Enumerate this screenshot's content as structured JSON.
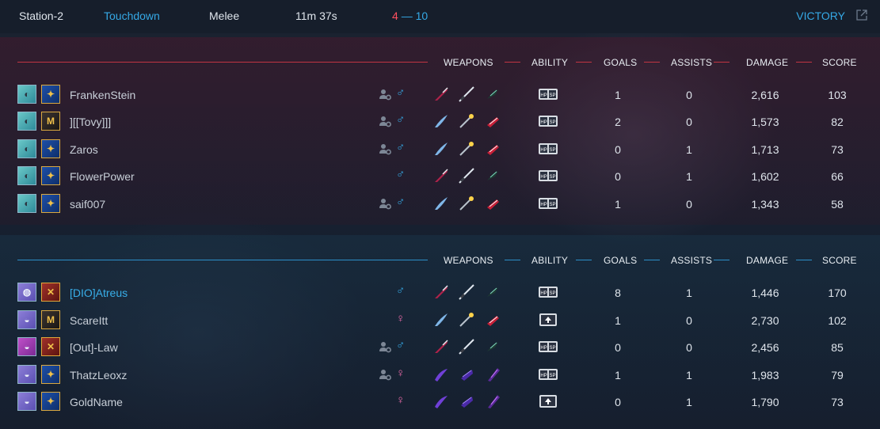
{
  "match": {
    "map": "Station-2",
    "mode": "Touchdown",
    "type": "Melee",
    "duration": "11m 37s",
    "score_red": "4",
    "score_sep": "—",
    "score_blue": "10",
    "result": "VICTORY"
  },
  "headers": {
    "weapons": "WEAPONS",
    "ability": "ABILITY",
    "goals": "GOALS",
    "assists": "ASSISTS",
    "damage": "DAMAGE",
    "score": "SCORE"
  },
  "colors": {
    "accent_blue": "#35a9e6",
    "accent_red": "#ff4f5f",
    "female_pink": "#e86aa8"
  },
  "teams": [
    {
      "side": "red",
      "players": [
        {
          "name": "FrankenStein",
          "voice": true,
          "gender": "male",
          "ability": "hp-sp",
          "goals": "1",
          "assists": "0",
          "damage": "2,616",
          "score": "103",
          "avatar": "owl",
          "rank": "p"
        },
        {
          "name": "][[Tovy]]]",
          "voice": true,
          "gender": "male",
          "ability": "hp-sp",
          "goals": "2",
          "assists": "0",
          "damage": "1,573",
          "score": "82",
          "avatar": "owl",
          "rank": "m"
        },
        {
          "name": "Zaros",
          "voice": true,
          "gender": "male",
          "ability": "hp-sp",
          "goals": "0",
          "assists": "1",
          "damage": "1,713",
          "score": "73",
          "avatar": "owl",
          "rank": "p"
        },
        {
          "name": "FlowerPower",
          "voice": false,
          "gender": "male",
          "ability": "hp-sp",
          "goals": "0",
          "assists": "1",
          "damage": "1,602",
          "score": "66",
          "avatar": "owl",
          "rank": "p"
        },
        {
          "name": "saif007",
          "voice": true,
          "gender": "male",
          "ability": "hp-sp",
          "goals": "1",
          "assists": "0",
          "damage": "1,343",
          "score": "58",
          "avatar": "owl",
          "rank": "p"
        }
      ]
    },
    {
      "side": "blue",
      "players": [
        {
          "name": "[DIO]Atreus",
          "voice": false,
          "gender": "male",
          "ability": "hp-sp",
          "goals": "8",
          "assists": "1",
          "damage": "1,446",
          "score": "170",
          "avatar": "globe",
          "rank": "x",
          "highlight": true
        },
        {
          "name": "ScareItt",
          "voice": false,
          "gender": "female",
          "ability": "boost",
          "goals": "1",
          "assists": "0",
          "damage": "2,730",
          "score": "102",
          "avatar": "ga",
          "rank": "m"
        },
        {
          "name": "[Out]-Law",
          "voice": true,
          "gender": "male",
          "ability": "hp-sp",
          "goals": "0",
          "assists": "0",
          "damage": "2,456",
          "score": "85",
          "avatar": "pink",
          "rank": "x"
        },
        {
          "name": "ThatzLeoxz",
          "voice": true,
          "gender": "female",
          "ability": "hp-sp",
          "goals": "1",
          "assists": "1",
          "damage": "1,983",
          "score": "79",
          "avatar": "ga",
          "rank": "p"
        },
        {
          "name": "GoldName",
          "voice": false,
          "gender": "female",
          "ability": "boost",
          "goals": "0",
          "assists": "1",
          "damage": "1,790",
          "score": "73",
          "avatar": "ga",
          "rank": "p"
        }
      ]
    }
  ]
}
